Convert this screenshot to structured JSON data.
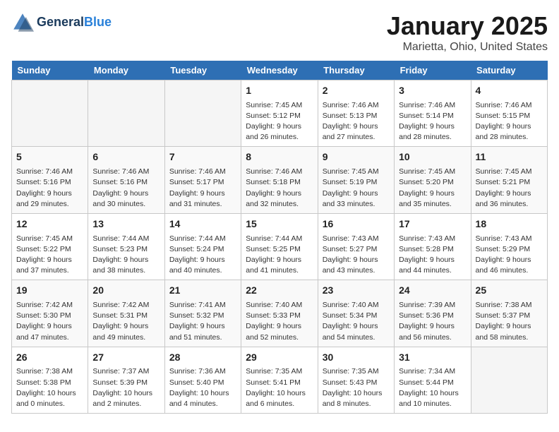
{
  "logo": {
    "line1": "General",
    "line2": "Blue"
  },
  "title": "January 2025",
  "subtitle": "Marietta, Ohio, United States",
  "days_of_week": [
    "Sunday",
    "Monday",
    "Tuesday",
    "Wednesday",
    "Thursday",
    "Friday",
    "Saturday"
  ],
  "weeks": [
    [
      {
        "day": "",
        "info": ""
      },
      {
        "day": "",
        "info": ""
      },
      {
        "day": "",
        "info": ""
      },
      {
        "day": "1",
        "info": "Sunrise: 7:45 AM\nSunset: 5:12 PM\nDaylight: 9 hours\nand 26 minutes."
      },
      {
        "day": "2",
        "info": "Sunrise: 7:46 AM\nSunset: 5:13 PM\nDaylight: 9 hours\nand 27 minutes."
      },
      {
        "day": "3",
        "info": "Sunrise: 7:46 AM\nSunset: 5:14 PM\nDaylight: 9 hours\nand 28 minutes."
      },
      {
        "day": "4",
        "info": "Sunrise: 7:46 AM\nSunset: 5:15 PM\nDaylight: 9 hours\nand 28 minutes."
      }
    ],
    [
      {
        "day": "5",
        "info": "Sunrise: 7:46 AM\nSunset: 5:16 PM\nDaylight: 9 hours\nand 29 minutes."
      },
      {
        "day": "6",
        "info": "Sunrise: 7:46 AM\nSunset: 5:16 PM\nDaylight: 9 hours\nand 30 minutes."
      },
      {
        "day": "7",
        "info": "Sunrise: 7:46 AM\nSunset: 5:17 PM\nDaylight: 9 hours\nand 31 minutes."
      },
      {
        "day": "8",
        "info": "Sunrise: 7:46 AM\nSunset: 5:18 PM\nDaylight: 9 hours\nand 32 minutes."
      },
      {
        "day": "9",
        "info": "Sunrise: 7:45 AM\nSunset: 5:19 PM\nDaylight: 9 hours\nand 33 minutes."
      },
      {
        "day": "10",
        "info": "Sunrise: 7:45 AM\nSunset: 5:20 PM\nDaylight: 9 hours\nand 35 minutes."
      },
      {
        "day": "11",
        "info": "Sunrise: 7:45 AM\nSunset: 5:21 PM\nDaylight: 9 hours\nand 36 minutes."
      }
    ],
    [
      {
        "day": "12",
        "info": "Sunrise: 7:45 AM\nSunset: 5:22 PM\nDaylight: 9 hours\nand 37 minutes."
      },
      {
        "day": "13",
        "info": "Sunrise: 7:44 AM\nSunset: 5:23 PM\nDaylight: 9 hours\nand 38 minutes."
      },
      {
        "day": "14",
        "info": "Sunrise: 7:44 AM\nSunset: 5:24 PM\nDaylight: 9 hours\nand 40 minutes."
      },
      {
        "day": "15",
        "info": "Sunrise: 7:44 AM\nSunset: 5:25 PM\nDaylight: 9 hours\nand 41 minutes."
      },
      {
        "day": "16",
        "info": "Sunrise: 7:43 AM\nSunset: 5:27 PM\nDaylight: 9 hours\nand 43 minutes."
      },
      {
        "day": "17",
        "info": "Sunrise: 7:43 AM\nSunset: 5:28 PM\nDaylight: 9 hours\nand 44 minutes."
      },
      {
        "day": "18",
        "info": "Sunrise: 7:43 AM\nSunset: 5:29 PM\nDaylight: 9 hours\nand 46 minutes."
      }
    ],
    [
      {
        "day": "19",
        "info": "Sunrise: 7:42 AM\nSunset: 5:30 PM\nDaylight: 9 hours\nand 47 minutes."
      },
      {
        "day": "20",
        "info": "Sunrise: 7:42 AM\nSunset: 5:31 PM\nDaylight: 9 hours\nand 49 minutes."
      },
      {
        "day": "21",
        "info": "Sunrise: 7:41 AM\nSunset: 5:32 PM\nDaylight: 9 hours\nand 51 minutes."
      },
      {
        "day": "22",
        "info": "Sunrise: 7:40 AM\nSunset: 5:33 PM\nDaylight: 9 hours\nand 52 minutes."
      },
      {
        "day": "23",
        "info": "Sunrise: 7:40 AM\nSunset: 5:34 PM\nDaylight: 9 hours\nand 54 minutes."
      },
      {
        "day": "24",
        "info": "Sunrise: 7:39 AM\nSunset: 5:36 PM\nDaylight: 9 hours\nand 56 minutes."
      },
      {
        "day": "25",
        "info": "Sunrise: 7:38 AM\nSunset: 5:37 PM\nDaylight: 9 hours\nand 58 minutes."
      }
    ],
    [
      {
        "day": "26",
        "info": "Sunrise: 7:38 AM\nSunset: 5:38 PM\nDaylight: 10 hours\nand 0 minutes."
      },
      {
        "day": "27",
        "info": "Sunrise: 7:37 AM\nSunset: 5:39 PM\nDaylight: 10 hours\nand 2 minutes."
      },
      {
        "day": "28",
        "info": "Sunrise: 7:36 AM\nSunset: 5:40 PM\nDaylight: 10 hours\nand 4 minutes."
      },
      {
        "day": "29",
        "info": "Sunrise: 7:35 AM\nSunset: 5:41 PM\nDaylight: 10 hours\nand 6 minutes."
      },
      {
        "day": "30",
        "info": "Sunrise: 7:35 AM\nSunset: 5:43 PM\nDaylight: 10 hours\nand 8 minutes."
      },
      {
        "day": "31",
        "info": "Sunrise: 7:34 AM\nSunset: 5:44 PM\nDaylight: 10 hours\nand 10 minutes."
      },
      {
        "day": "",
        "info": ""
      }
    ]
  ]
}
